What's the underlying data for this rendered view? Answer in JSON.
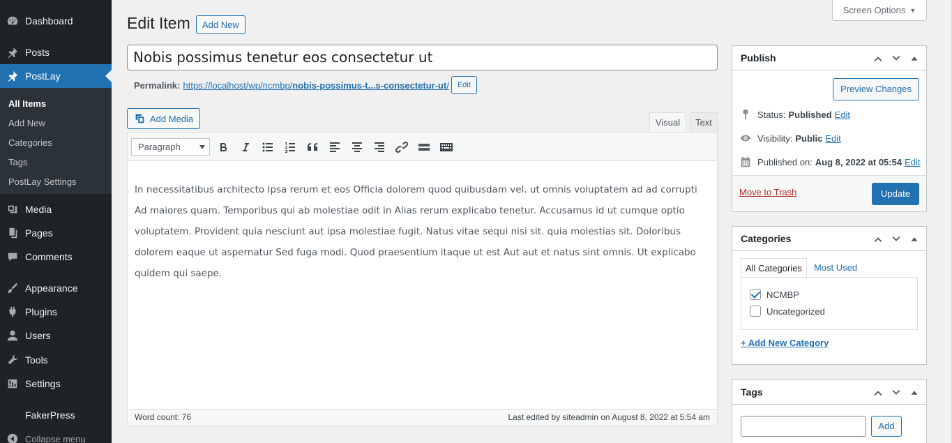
{
  "sidebar": {
    "dashboard": "Dashboard",
    "posts": "Posts",
    "postlay": "PostLay",
    "sub": {
      "all_items": "All Items",
      "add_new": "Add New",
      "categories": "Categories",
      "tags": "Tags",
      "settings": "PostLay Settings"
    },
    "media": "Media",
    "pages": "Pages",
    "comments": "Comments",
    "appearance": "Appearance",
    "plugins": "Plugins",
    "users": "Users",
    "tools": "Tools",
    "settings": "Settings",
    "fakerpress": "FakerPress",
    "collapse": "Collapse menu"
  },
  "screen_options": "Screen Options",
  "page": {
    "title": "Edit Item",
    "add_new": "Add New",
    "post_title": "Nobis possimus tenetur eos consectetur ut",
    "permalink_label": "Permalink:",
    "permalink_base": "https://localhost/wp/ncmbp/",
    "permalink_slug": "nobis-possimus-t...s-consectetur-ut",
    "permalink_trail": "/",
    "permalink_edit": "Edit"
  },
  "editor": {
    "add_media": "Add Media",
    "tab_visual": "Visual",
    "tab_text": "Text",
    "format": "Paragraph",
    "content": "In necessitatibus architecto Ipsa rerum et eos Officia dolorem quod quibusdam vel. ut omnis voluptatem ad ad corrupti Ad maiores quam. Temporibus qui ab molestiae odit in Alias rerum explicabo tenetur. Accusamus id ut cumque optio voluptatem. Provident quia nesciunt aut ipsa molestiae fugit. Natus vitae sequi nisi sit. quia molestias sit. Doloribus dolorem eaque ut aspernatur Sed fuga modi. Quod praesentium itaque ut est Aut aut et natus sint omnis. Ut explicabo quidem qui saepe.",
    "word_count": "Word count: 76",
    "last_edited": "Last edited by siteadmin on August 8, 2022 at 5:54 am"
  },
  "publish": {
    "title": "Publish",
    "preview": "Preview Changes",
    "status_label": "Status:",
    "status_value": "Published",
    "visibility_label": "Visibility:",
    "visibility_value": "Public",
    "published_label": "Published on:",
    "published_value": "Aug 8, 2022 at 05:54",
    "edit": "Edit",
    "trash": "Move to Trash",
    "update": "Update"
  },
  "categories": {
    "title": "Categories",
    "tab_all": "All Categories",
    "tab_most_used": "Most Used",
    "items": [
      {
        "label": "NCMBP",
        "checked": true
      },
      {
        "label": "Uncategorized",
        "checked": false
      }
    ],
    "add_new": "+ Add New Category"
  },
  "tags": {
    "title": "Tags",
    "add": "Add"
  },
  "colors": {
    "accent": "#2271b1",
    "menu_bg": "#1d2327",
    "trash": "#b32d2e"
  }
}
